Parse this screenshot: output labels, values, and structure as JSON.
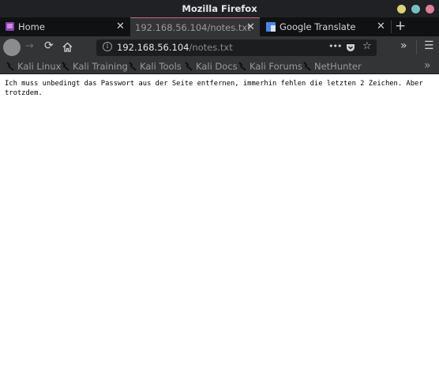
{
  "window": {
    "title": "Mozilla Firefox"
  },
  "tabs": [
    {
      "label": "Home"
    },
    {
      "label": "192.168.56.104/notes.txt"
    },
    {
      "label": "Google Translate"
    }
  ],
  "navbar": {
    "url_host": "192.168.56.104",
    "url_path": "/notes.txt",
    "page_actions_label": "•••"
  },
  "bookmarks": [
    {
      "label": "Kali Linux"
    },
    {
      "label": "Kali Training"
    },
    {
      "label": "Kali Tools"
    },
    {
      "label": "Kali Docs"
    },
    {
      "label": "Kali Forums"
    },
    {
      "label": "NetHunter"
    }
  ],
  "page": {
    "text": "Ich muss unbedingt das Passwort aus der Seite entfernen, immerhin fehlen die letzten 2 Zeichen. Aber trotzdem."
  },
  "colors": {
    "titlebar": "#1f2124",
    "tabstrip": "#0f1113",
    "toolbar": "#323436",
    "urlbar": "#1c1d1f",
    "active_tab_accent": "#d7617a",
    "minimize": "#e0d371",
    "maximize": "#78bfc5",
    "close": "#e07d96"
  },
  "icons": {
    "home_tab": "kali-home-icon",
    "translate_tab": "google-translate-icon",
    "bookmark": "kali-dragon-icon"
  }
}
